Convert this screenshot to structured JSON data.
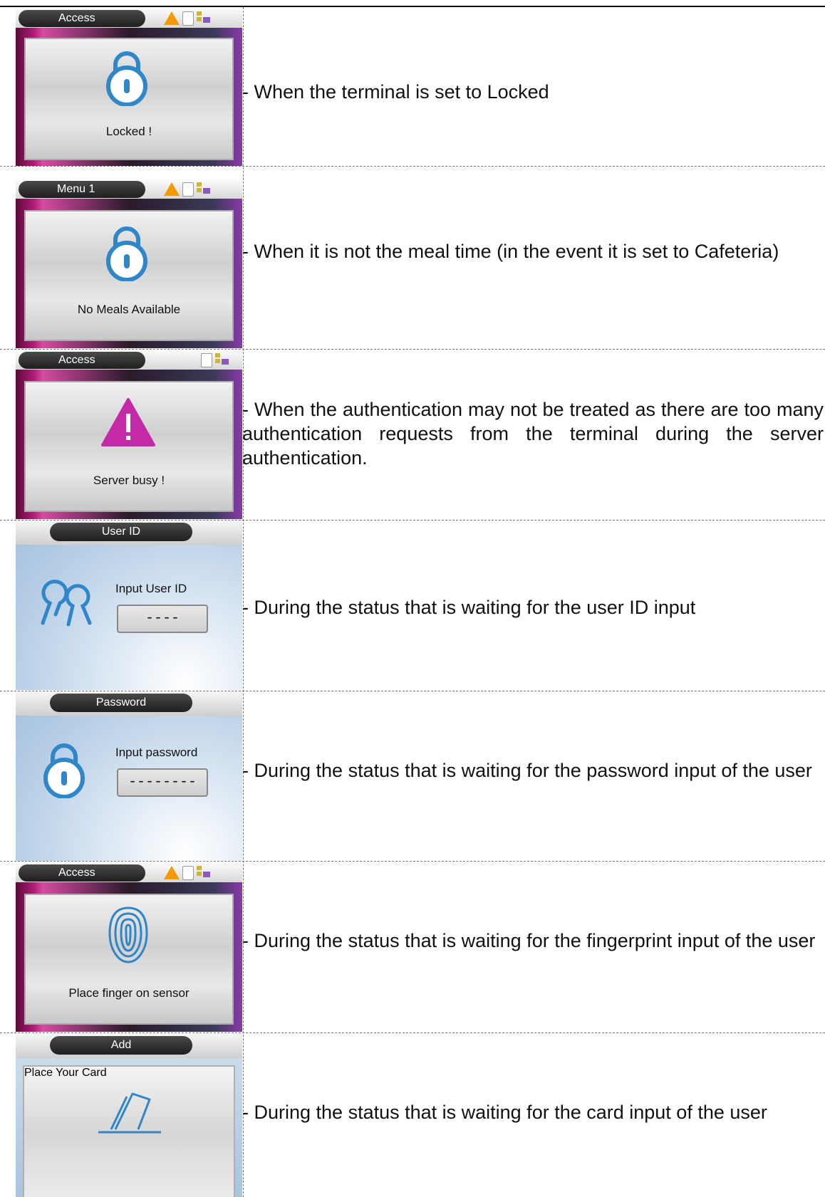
{
  "rows": [
    {
      "screen": {
        "title": "Access",
        "message": "Locked !",
        "icon": "lock-icon",
        "show_warning": true
      },
      "description": "- When the terminal is set to Locked"
    },
    {
      "screen": {
        "title": "Menu 1",
        "message": "No Meals Available",
        "icon": "lock-icon",
        "show_warning": true
      },
      "description": "- When it is not the meal time (in the event it is set to Cafeteria)"
    },
    {
      "screen": {
        "title": "Access",
        "message": "Server busy !",
        "icon": "warning-triangle-icon",
        "show_warning": false
      },
      "description": "- When the authentication may not be treated as there are too many authentication requests from the terminal during the server authentication."
    },
    {
      "screen": {
        "title": "User ID",
        "prompt": "Input User ID",
        "field_value": "----",
        "icon": "users-icon"
      },
      "description": "- During the status that is waiting for the user ID input"
    },
    {
      "screen": {
        "title": "Password",
        "prompt": "Input password",
        "field_value": "--------",
        "icon": "lock-icon"
      },
      "description": "- During the status that is waiting for the password input of the user"
    },
    {
      "screen": {
        "title": "Access",
        "message": "Place finger on sensor",
        "icon": "fingerprint-icon",
        "show_warning": true
      },
      "description": "- During the status that is waiting for the fingerprint input of the user"
    },
    {
      "screen": {
        "title": "Add",
        "message": "Place Your Card",
        "icon": "card-icon"
      },
      "description": "- During the status that is waiting for the card input of the user"
    }
  ],
  "colors": {
    "warning": "#f29a00",
    "alert": "#c42aa8",
    "icon_blue": "#2f86c8"
  }
}
